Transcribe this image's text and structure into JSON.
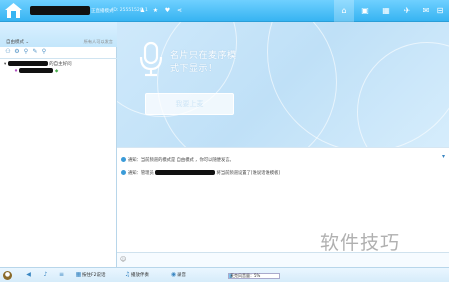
{
  "titlebar": {
    "mode": "正直播模式",
    "room_id": "ID: 25551520",
    "count": "1",
    "icons": [
      "star-icon",
      "heart-icon",
      "share-icon"
    ],
    "right_buttons": [
      "home-icon",
      "square-icon",
      "grid-icon",
      "tool-icon",
      "chat-icon",
      "info-icon"
    ]
  },
  "left": {
    "mode_label": "自由模式 ⌄",
    "hint": "所有人可以发言",
    "owner_suffix": "的自主好问",
    "tools": [
      "person-icon",
      "settings-icon",
      "pin-icon",
      "edit-icon",
      "search-icon"
    ]
  },
  "stage": {
    "line1": "名片只在麦序模",
    "line2": "式下显示！",
    "button": "我要上麦"
  },
  "chat": {
    "notice1": "通知：当前频道的模式是 自由模式 ，你可以随便发言。",
    "notice2_prefix": "通知：管理员",
    "notice2_suffix": "将当前频道设置了[谁说话谁模板]"
  },
  "watermark": "软件技巧",
  "bottom": {
    "f2": "按住F2说话",
    "bgm": "播放伴奏",
    "record": "录音",
    "volume_label": "麦克风音量：5%",
    "volume_fraction": 0.05
  },
  "colors": {
    "titlebar": "#37b4f2",
    "stage": "#cfe9fb",
    "accent": "#3b9bd8"
  }
}
